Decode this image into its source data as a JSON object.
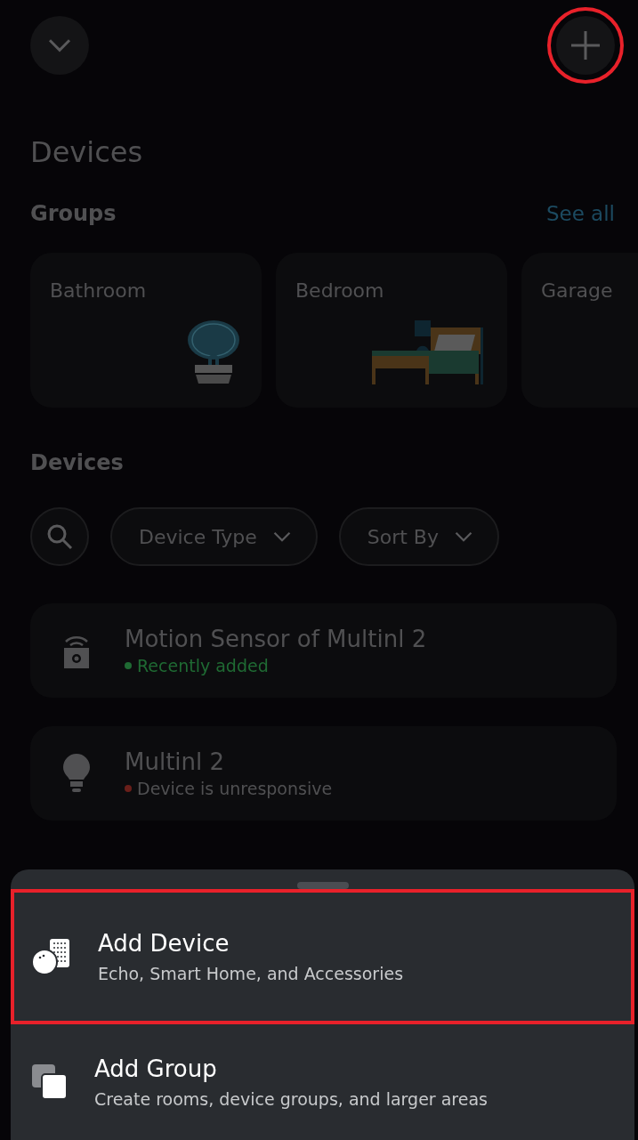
{
  "top_bar": {
    "add_button": {
      "highlighted": true
    }
  },
  "title": "Devices",
  "groups": {
    "heading": "Groups",
    "see_all": "See all",
    "items": [
      {
        "label": "Bathroom",
        "kind": "sink"
      },
      {
        "label": "Bedroom",
        "kind": "bed"
      },
      {
        "label": "Garage",
        "kind": "none"
      }
    ]
  },
  "devices": {
    "heading": "Devices",
    "filters": [
      {
        "label": "Device Type"
      },
      {
        "label": "Sort By"
      }
    ],
    "items": [
      {
        "name": "Motion Sensor of Multinl 2",
        "kind": "sensor",
        "status": "Recently added",
        "color": "#1f6a33"
      },
      {
        "name": "Multinl 2",
        "kind": "bulb",
        "status": "Device is unresponsive",
        "color": "#6a1f1a"
      }
    ]
  },
  "sheet": {
    "items": [
      {
        "title": "Add Device",
        "subtitle": "Echo, Smart Home, and Accessories",
        "kind": "device",
        "highlighted": true
      },
      {
        "title": "Add Group",
        "subtitle": "Create rooms, device groups, and larger areas",
        "kind": "group",
        "highlighted": false
      }
    ]
  }
}
